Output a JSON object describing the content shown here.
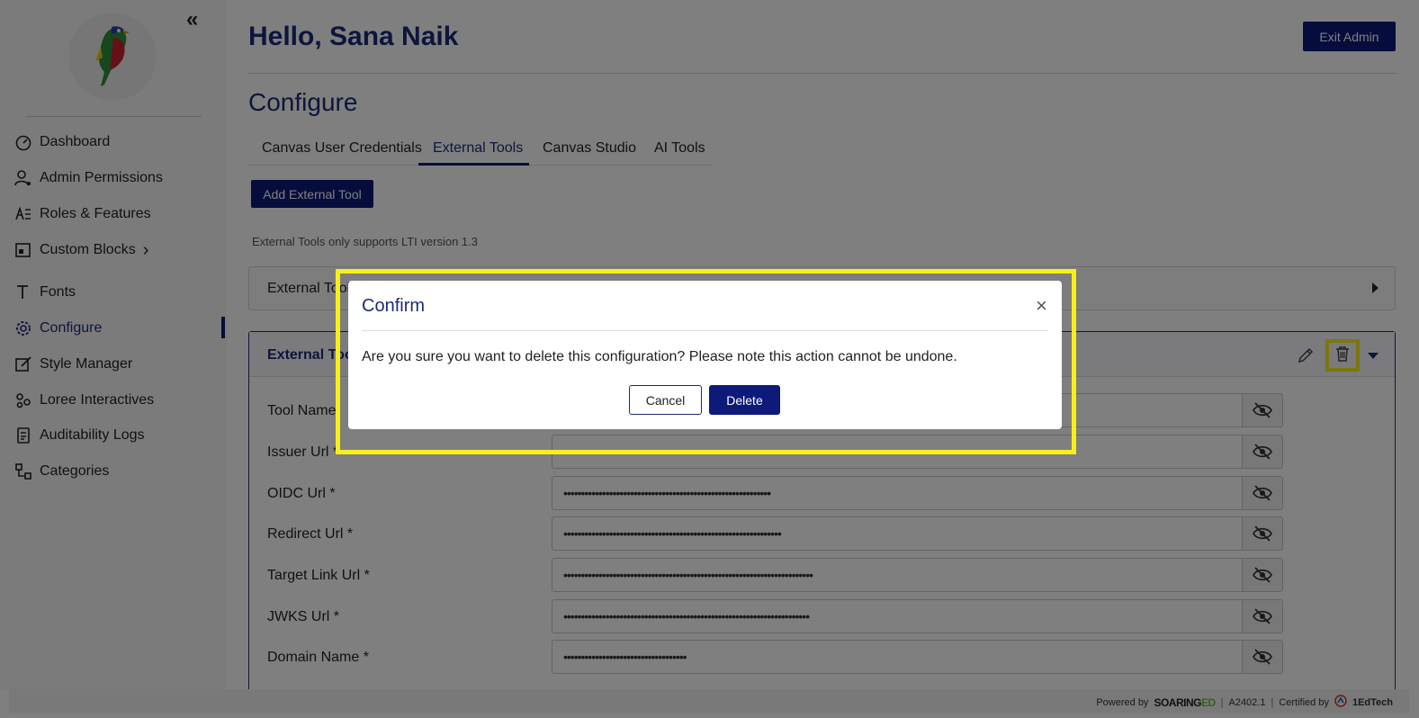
{
  "header": {
    "greeting": "Hello, Sana Naik",
    "exit_admin_label": "Exit Admin"
  },
  "sidebar": {
    "collapse_glyph": "«",
    "logo_icon": "parrot-logo",
    "items": [
      {
        "label": "Dashboard",
        "icon": "dashboard-icon"
      },
      {
        "label": "Admin Permissions",
        "icon": "user-permissions-icon"
      },
      {
        "label": "Roles & Features",
        "icon": "roles-icon"
      },
      {
        "label": "Custom Blocks",
        "icon": "blocks-icon",
        "chevron": "›"
      },
      {
        "label": "Fonts",
        "icon": "font-icon"
      },
      {
        "label": "Configure",
        "icon": "configure-icon",
        "active": true
      },
      {
        "label": "Style Manager",
        "icon": "style-icon"
      },
      {
        "label": "Loree Interactives",
        "icon": "interactives-icon"
      },
      {
        "label": "Auditability Logs",
        "icon": "logs-icon"
      },
      {
        "label": "Categories",
        "icon": "categories-icon"
      }
    ]
  },
  "main": {
    "title": "Configure",
    "tabs": [
      {
        "label": "Canvas User Credentials"
      },
      {
        "label": "External Tools",
        "active": true
      },
      {
        "label": "Canvas Studio"
      },
      {
        "label": "AI Tools"
      }
    ],
    "add_button_label": "Add External Tool",
    "lti_note": "External Tools only supports LTI version 1.3",
    "panel1_title": "External Tool",
    "panel2_title": "External Tool",
    "fields": [
      {
        "label": "Tool Name",
        "value": ""
      },
      {
        "label": "Issuer Url *",
        "value": "••••••••••••••••••••••••••••••••••••••••••••••••••••••••••••••••••••••••••••••••"
      },
      {
        "label": "OIDC Url *",
        "value": "•••••••••••••••••••••••••••••••••••••••••••••••••••••••••••"
      },
      {
        "label": "Redirect Url *",
        "value": "••••••••••••••••••••••••••••••••••••••••••••••••••••••••••••••"
      },
      {
        "label": "Target Link Url *",
        "value": "•••••••••••••••••••••••••••••••••••••••••••••••••••••••••••••••••••••••"
      },
      {
        "label": "JWKS Url *",
        "value": "••••••••••••••••••••••••••••••••••••••••••••••••••••••••••••••••••••••"
      },
      {
        "label": "Domain Name *",
        "value": "•••••••••••••••••••••••••••••••••••"
      }
    ]
  },
  "modal": {
    "title": "Confirm",
    "close_glyph": "×",
    "message": "Are you sure you want to delete this configuration? Please note this action cannot be undone.",
    "cancel_label": "Cancel",
    "delete_label": "Delete"
  },
  "footer": {
    "powered_by": "Powered by",
    "brand_a": "SOARING",
    "brand_b": "ED",
    "separator": "|",
    "version": "A2402.1",
    "certified_by": "Certified by",
    "certifier": "1EdTech"
  },
  "colors": {
    "primary": "#0d1a7a",
    "title": "#1c2a78",
    "highlight": "#f7ef1a"
  }
}
